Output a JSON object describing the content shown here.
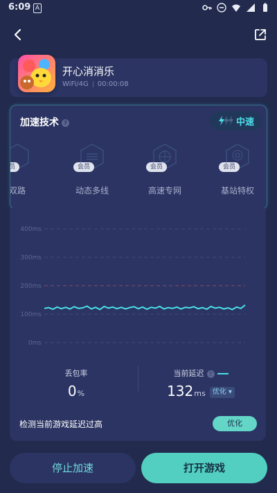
{
  "status_bar": {
    "time": "6:09",
    "notification_icon": "A"
  },
  "header": {
    "back_icon": "chevron-left-icon",
    "share_icon": "share-icon"
  },
  "game": {
    "name": "开心消消乐",
    "network": "WiFi/4G",
    "duration": "00:00:08"
  },
  "accel": {
    "title": "加速技术",
    "mode": "中速",
    "techs": [
      {
        "label": "双路",
        "badge": "会员"
      },
      {
        "label": "动态多线",
        "badge": "会员"
      },
      {
        "label": "高速专网",
        "badge": "会员"
      },
      {
        "label": "基站特权",
        "badge": "会员"
      }
    ]
  },
  "chart_data": {
    "type": "line",
    "ylabels": [
      "400ms",
      "300ms",
      "200ms",
      "100ms",
      "0ms"
    ],
    "ylim": [
      0,
      400
    ],
    "threshold": 200,
    "series": [
      {
        "values": [
          120,
          123,
          117,
          125,
          119,
          124,
          118,
          126,
          120,
          122,
          128,
          118,
          124,
          116,
          127,
          121,
          125,
          119,
          124,
          118,
          123,
          126,
          119,
          125,
          117,
          124,
          121,
          127,
          118,
          123,
          120,
          125,
          118,
          124,
          122,
          126,
          119,
          123,
          117,
          127,
          121,
          124,
          118,
          122,
          116,
          125,
          120,
          132
        ]
      }
    ],
    "color": "#4ce0ea"
  },
  "stats": {
    "loss_label": "丢包率",
    "loss_value": "0",
    "loss_unit": "%",
    "latency_label": "当前延迟",
    "latency_value": "132",
    "latency_unit": "ms",
    "optimize_tag": "优化"
  },
  "warning": {
    "text": "检测当前游戏延迟过高",
    "button": "优化"
  },
  "actions": {
    "stop": "停止加速",
    "open": "打开游戏"
  }
}
